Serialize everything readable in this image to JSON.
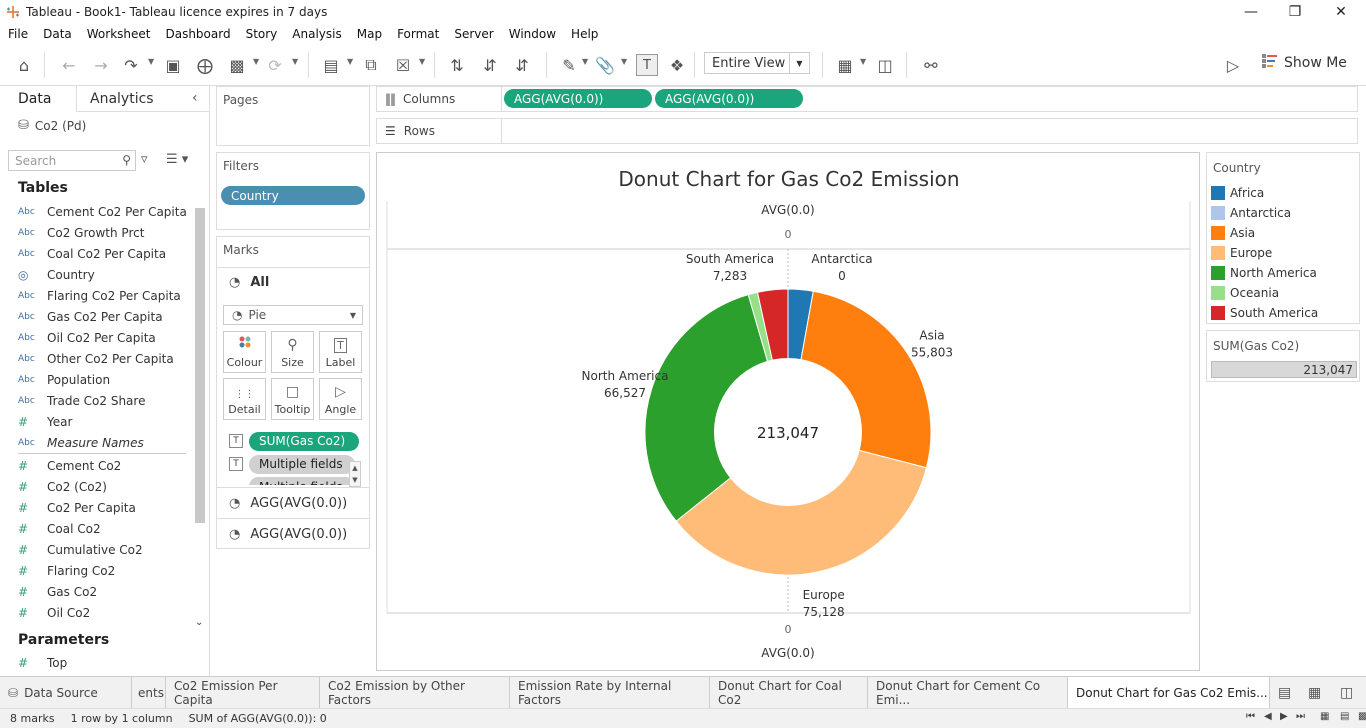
{
  "window": {
    "title": "Tableau - Book1- Tableau licence expires in 7 days",
    "minimize": "—",
    "restore": "❐",
    "close": "✕"
  },
  "menu": [
    "File",
    "Data",
    "Worksheet",
    "Dashboard",
    "Story",
    "Analysis",
    "Map",
    "Format",
    "Server",
    "Window",
    "Help"
  ],
  "toolbar": {
    "view_select": "Entire View",
    "show_me": "Show Me"
  },
  "data_pane": {
    "tab_data": "Data",
    "tab_analytics": "Analytics",
    "datasource": "Co2 (Pd)",
    "search_placeholder": "Search",
    "tables_heading": "Tables",
    "dimensions": [
      {
        "type": "Abc",
        "label": "Cement Co2 Per Capita"
      },
      {
        "type": "Abc",
        "label": "Co2 Growth Prct"
      },
      {
        "type": "Abc",
        "label": "Coal Co2 Per Capita"
      },
      {
        "type": "geo",
        "label": "Country"
      },
      {
        "type": "Abc",
        "label": "Flaring Co2 Per Capita"
      },
      {
        "type": "Abc",
        "label": "Gas Co2 Per Capita"
      },
      {
        "type": "Abc",
        "label": "Oil Co2 Per Capita"
      },
      {
        "type": "Abc",
        "label": "Other Co2 Per Capita"
      },
      {
        "type": "Abc",
        "label": "Population"
      },
      {
        "type": "Abc",
        "label": "Trade Co2 Share"
      },
      {
        "type": "#",
        "label": "Year"
      },
      {
        "type": "Abc",
        "label": "Measure Names"
      }
    ],
    "measures": [
      {
        "type": "#",
        "label": "Cement Co2"
      },
      {
        "type": "#",
        "label": "Co2 (Co2)"
      },
      {
        "type": "#",
        "label": "Co2 Per Capita"
      },
      {
        "type": "#",
        "label": "Coal Co2"
      },
      {
        "type": "#",
        "label": "Cumulative Co2"
      },
      {
        "type": "#",
        "label": "Flaring Co2"
      },
      {
        "type": "#",
        "label": "Gas Co2"
      },
      {
        "type": "#",
        "label": "Oil Co2"
      }
    ],
    "parameters_heading": "Parameters",
    "parameters": [
      {
        "type": "#",
        "label": "Top"
      }
    ]
  },
  "pages": {
    "heading": "Pages"
  },
  "filters": {
    "heading": "Filters",
    "pills": [
      "Country"
    ]
  },
  "marks": {
    "heading": "Marks",
    "all_label": "All",
    "mark_type": "Pie",
    "buttons": [
      "Colour",
      "Size",
      "Label",
      "Detail",
      "Tooltip",
      "Angle"
    ],
    "encodings": [
      "SUM(Gas Co2)",
      "Multiple fields",
      "Multiple fields"
    ],
    "agg_rows": [
      "AGG(AVG(0.0))",
      "AGG(AVG(0.0))"
    ]
  },
  "columns": {
    "label": "Columns",
    "pills": [
      "AGG(AVG(0.0))",
      "AGG(AVG(0.0))"
    ]
  },
  "rows": {
    "label": "Rows"
  },
  "chart_data": {
    "type": "pie",
    "title": "Donut Chart for Gas Co2 Emission",
    "top_axis_title": "AVG(0.0)",
    "top_axis_tick": "0",
    "bottom_axis_tick": "0",
    "bottom_axis_title": "AVG(0.0)",
    "center_label": "213,047",
    "slices": [
      {
        "name": "Africa",
        "value": 6030,
        "color": "#1f77b4",
        "label": "",
        "value_label": ""
      },
      {
        "name": "Antarctica",
        "value": 0,
        "color": "#aec7e8",
        "label": "Antarctica",
        "value_label": "0"
      },
      {
        "name": "Asia",
        "value": 55803,
        "color": "#ff7f0e",
        "label": "Asia",
        "value_label": "55,803"
      },
      {
        "name": "Europe",
        "value": 75128,
        "color": "#ffbb78",
        "label": "Europe",
        "value_label": "75,128"
      },
      {
        "name": "North America",
        "value": 66527,
        "color": "#2ca02c",
        "label": "North America",
        "value_label": "66,527"
      },
      {
        "name": "Oceania",
        "value": 2276,
        "color": "#98df8a",
        "label": "",
        "value_label": ""
      },
      {
        "name": "South America",
        "value": 7283,
        "color": "#d62728",
        "label": "South America",
        "value_label": "7,283"
      }
    ]
  },
  "legend": {
    "heading": "Country",
    "items": [
      {
        "label": "Africa",
        "color": "#1f77b4"
      },
      {
        "label": "Antarctica",
        "color": "#aec7e8"
      },
      {
        "label": "Asia",
        "color": "#ff7f0e"
      },
      {
        "label": "Europe",
        "color": "#ffbb78"
      },
      {
        "label": "North America",
        "color": "#2ca02c"
      },
      {
        "label": "Oceania",
        "color": "#98df8a"
      },
      {
        "label": "South America",
        "color": "#d62728"
      }
    ]
  },
  "size_legend": {
    "heading": "SUM(Gas Co2)",
    "value": "213,047"
  },
  "sheet_tabs": [
    {
      "label": "Data Source",
      "active": false
    },
    {
      "label": "ents",
      "active": false
    },
    {
      "label": "Co2 Emission Per Capita",
      "active": false
    },
    {
      "label": "Co2 Emission by Other Factors",
      "active": false
    },
    {
      "label": "Emission Rate by Internal Factors",
      "active": false
    },
    {
      "label": "Donut Chart for Coal Co2",
      "active": false
    },
    {
      "label": "Donut Chart for Cement Co Emi...",
      "active": false
    },
    {
      "label": "Donut Chart for Gas Co2 Emis...",
      "active": true
    }
  ],
  "status": {
    "marks": "8 marks",
    "rows_cols": "1 row by 1 column",
    "sum": "SUM of AGG(AVG(0.0)): 0"
  }
}
